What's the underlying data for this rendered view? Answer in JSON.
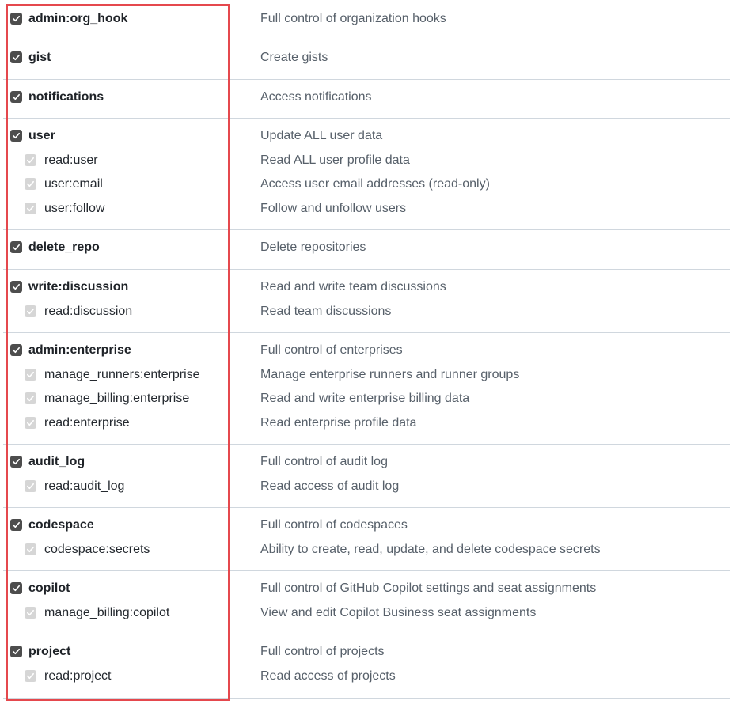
{
  "accent": {
    "highlight": "#e5484d",
    "checkbox_checked": "#4d4d4d",
    "checkbox_inherited": "#d6d6d6"
  },
  "scopes": [
    {
      "name": "admin:org_hook",
      "description": "Full control of organization hooks",
      "checked": true,
      "children": []
    },
    {
      "name": "gist",
      "description": "Create gists",
      "checked": true,
      "children": []
    },
    {
      "name": "notifications",
      "description": "Access notifications",
      "checked": true,
      "children": []
    },
    {
      "name": "user",
      "description": "Update ALL user data",
      "checked": true,
      "children": [
        {
          "name": "read:user",
          "description": "Read ALL user profile data",
          "checked": true
        },
        {
          "name": "user:email",
          "description": "Access user email addresses (read-only)",
          "checked": true
        },
        {
          "name": "user:follow",
          "description": "Follow and unfollow users",
          "checked": true
        }
      ]
    },
    {
      "name": "delete_repo",
      "description": "Delete repositories",
      "checked": true,
      "children": []
    },
    {
      "name": "write:discussion",
      "description": "Read and write team discussions",
      "checked": true,
      "children": [
        {
          "name": "read:discussion",
          "description": "Read team discussions",
          "checked": true
        }
      ]
    },
    {
      "name": "admin:enterprise",
      "description": "Full control of enterprises",
      "checked": true,
      "children": [
        {
          "name": "manage_runners:enterprise",
          "description": "Manage enterprise runners and runner groups",
          "checked": true
        },
        {
          "name": "manage_billing:enterprise",
          "description": "Read and write enterprise billing data",
          "checked": true
        },
        {
          "name": "read:enterprise",
          "description": "Read enterprise profile data",
          "checked": true
        }
      ]
    },
    {
      "name": "audit_log",
      "description": "Full control of audit log",
      "checked": true,
      "children": [
        {
          "name": "read:audit_log",
          "description": "Read access of audit log",
          "checked": true
        }
      ]
    },
    {
      "name": "codespace",
      "description": "Full control of codespaces",
      "checked": true,
      "children": [
        {
          "name": "codespace:secrets",
          "description": "Ability to create, read, update, and delete codespace secrets",
          "checked": true
        }
      ]
    },
    {
      "name": "copilot",
      "description": "Full control of GitHub Copilot settings and seat assignments",
      "checked": true,
      "children": [
        {
          "name": "manage_billing:copilot",
          "description": "View and edit Copilot Business seat assignments",
          "checked": true
        }
      ]
    },
    {
      "name": "project",
      "description": "Full control of projects",
      "checked": true,
      "children": [
        {
          "name": "read:project",
          "description": "Read access of projects",
          "checked": true
        }
      ]
    }
  ]
}
